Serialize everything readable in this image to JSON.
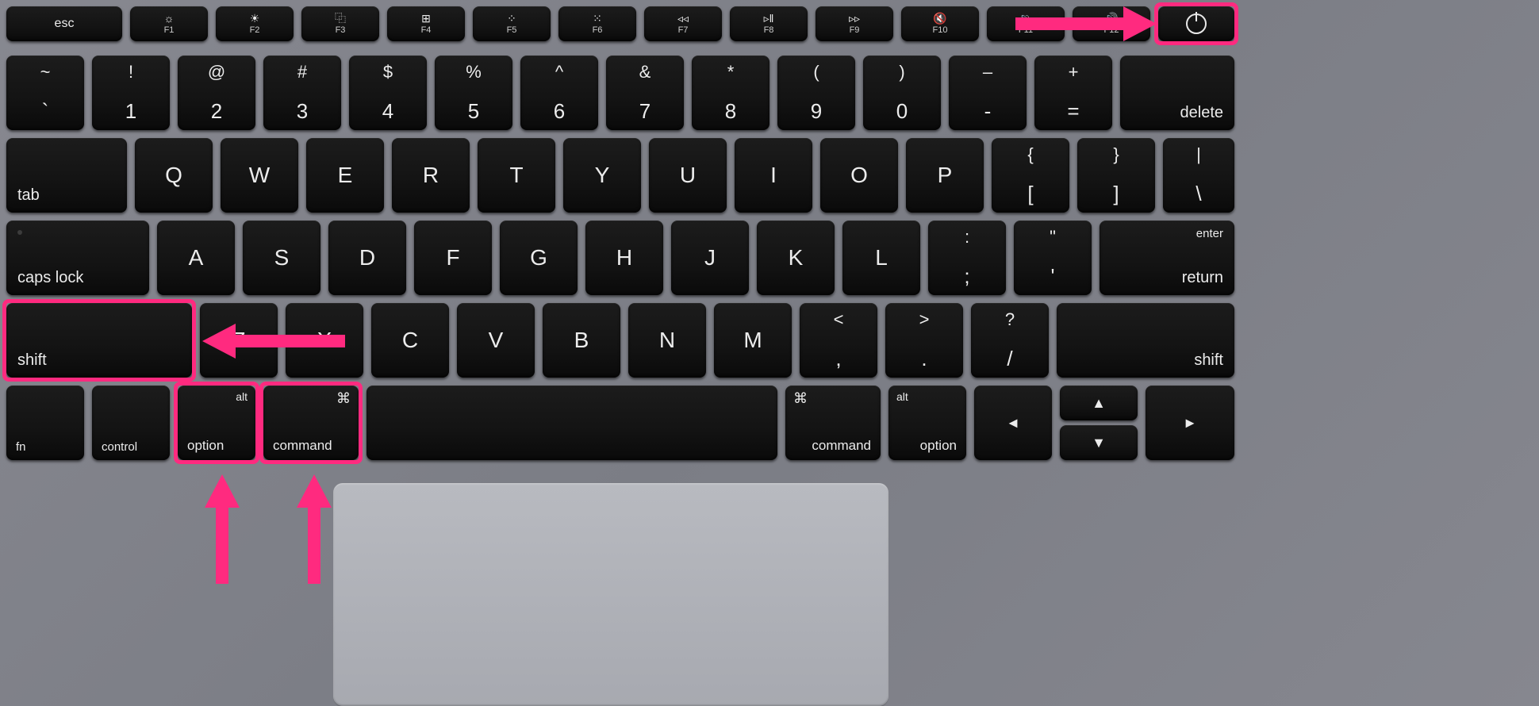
{
  "annotation": {
    "highlighted_keys": [
      "shift-left",
      "option-left",
      "command-left",
      "power"
    ],
    "relation": "shortcut-combo",
    "arrows": [
      "to-power",
      "to-shift",
      "to-option",
      "to-command"
    ],
    "color": "#ff2a7f"
  },
  "fnRow": {
    "esc": {
      "label": "esc"
    },
    "f1": {
      "icon": "☼",
      "sub": "F1"
    },
    "f2": {
      "icon": "☀",
      "sub": "F2"
    },
    "f3": {
      "icon": "⿻",
      "sub": "F3"
    },
    "f4": {
      "icon": "⊞",
      "sub": "F4"
    },
    "f5": {
      "icon": "⁘",
      "sub": "F5"
    },
    "f6": {
      "icon": "⁙",
      "sub": "F6"
    },
    "f7": {
      "icon": "◃◃",
      "sub": "F7"
    },
    "f8": {
      "icon": "▹ǁ",
      "sub": "F8"
    },
    "f9": {
      "icon": "▹▹",
      "sub": "F9"
    },
    "f10": {
      "icon": "🔇",
      "sub": "F10"
    },
    "f11": {
      "icon": "🔉",
      "sub": "F11"
    },
    "f12": {
      "icon": "🔊",
      "sub": "F12"
    },
    "power": {
      "icon": "⏻"
    }
  },
  "row1": {
    "tilde": {
      "top": "~",
      "bot": "`"
    },
    "1": {
      "top": "!",
      "bot": "1"
    },
    "2": {
      "top": "@",
      "bot": "2"
    },
    "3": {
      "top": "#",
      "bot": "3"
    },
    "4": {
      "top": "$",
      "bot": "4"
    },
    "5": {
      "top": "%",
      "bot": "5"
    },
    "6": {
      "top": "^",
      "bot": "6"
    },
    "7": {
      "top": "&",
      "bot": "7"
    },
    "8": {
      "top": "*",
      "bot": "8"
    },
    "9": {
      "top": "(",
      "bot": "9"
    },
    "0": {
      "top": ")",
      "bot": "0"
    },
    "minus": {
      "top": "–",
      "bot": "-"
    },
    "equal": {
      "top": "+",
      "bot": "="
    },
    "delete": {
      "label": "delete"
    }
  },
  "row2": {
    "tab": {
      "label": "tab"
    },
    "q": "Q",
    "w": "W",
    "e": "E",
    "r": "R",
    "t": "T",
    "y": "Y",
    "u": "U",
    "i": "I",
    "o": "O",
    "p": "P",
    "lbr": {
      "top": "{",
      "bot": "["
    },
    "rbr": {
      "top": "}",
      "bot": "]"
    },
    "bsl": {
      "top": "|",
      "bot": "\\"
    }
  },
  "row3": {
    "caps": {
      "label": "caps lock"
    },
    "a": "A",
    "s": "S",
    "d": "D",
    "f": "F",
    "g": "G",
    "h": "H",
    "j": "J",
    "k": "K",
    "l": "L",
    "semi": {
      "top": ":",
      "bot": ";"
    },
    "quote": {
      "top": "\"",
      "bot": "'"
    },
    "return": {
      "top": "enter",
      "bot": "return"
    }
  },
  "row4": {
    "shiftL": {
      "label": "shift"
    },
    "z": "Z",
    "x": "X",
    "c": "C",
    "v": "V",
    "b": "B",
    "n": "N",
    "m": "M",
    "comma": {
      "top": "<",
      "bot": ","
    },
    "period": {
      "top": ">",
      "bot": "."
    },
    "slash": {
      "top": "?",
      "bot": "/"
    },
    "shiftR": {
      "label": "shift"
    }
  },
  "row5": {
    "fn": {
      "label": "fn"
    },
    "ctrl": {
      "label": "control"
    },
    "optL": {
      "top": "alt",
      "bot": "option"
    },
    "cmdL": {
      "top": "⌘",
      "bot": "command"
    },
    "space": "",
    "cmdR": {
      "top": "⌘",
      "bot": "command"
    },
    "optR": {
      "top": "alt",
      "bot": "option"
    },
    "left": "◄",
    "up": "▲",
    "down": "▼",
    "right": "►"
  }
}
